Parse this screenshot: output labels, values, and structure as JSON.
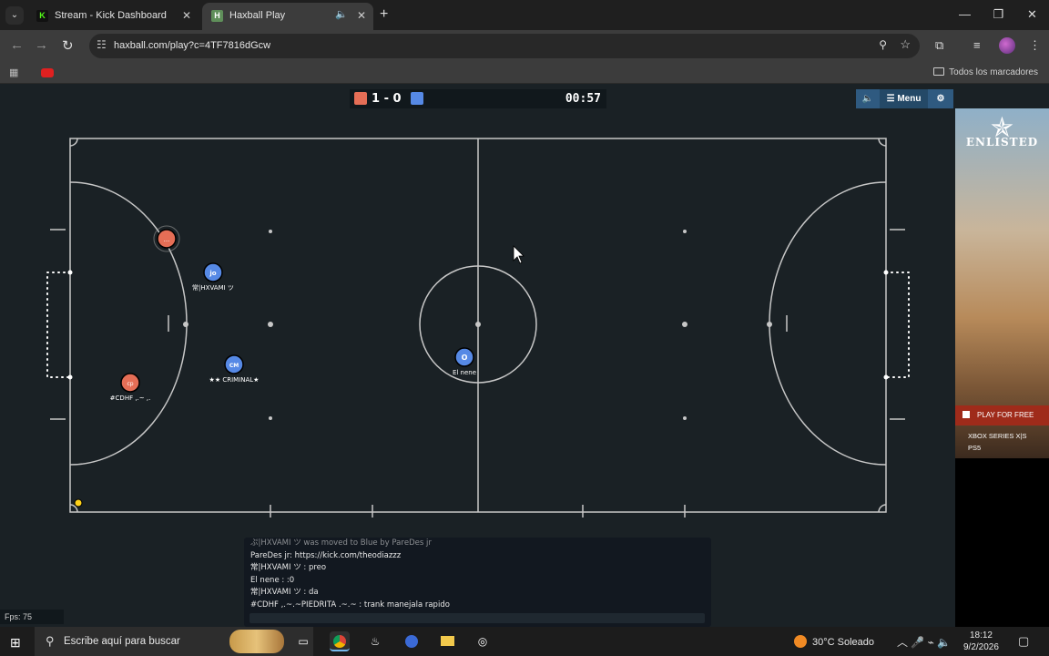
{
  "browser": {
    "tabs": [
      {
        "title": "Stream - Kick Dashboard",
        "favicon": "kick-icon",
        "color": "#53fc18"
      },
      {
        "title": "Haxball Play",
        "favicon": "haxball-icon",
        "color": "#5f8f5a"
      }
    ],
    "url": "haxball.com/play?c=4TF7816dGcw",
    "bookmarks_all": "Todos los marcadores"
  },
  "game": {
    "score": "1 - 0",
    "timer": "00:57",
    "menu_label": "Menu",
    "team_colors": {
      "red": "#e56e56",
      "blue": "#5689e5"
    },
    "players": [
      {
        "team": "red",
        "avatar": "...",
        "name": ""
      },
      {
        "team": "blue",
        "avatar": "jo",
        "name": "常|HXVAMI ツ"
      },
      {
        "team": "blue",
        "avatar": "CM",
        "name": "★★ CRIMINAL★"
      },
      {
        "team": "red",
        "avatar": "cp",
        "name": "#CDHF ,.~ ,."
      },
      {
        "team": "blue",
        "avatar": "O",
        "name": "El nene"
      }
    ],
    "fps": "Fps: 75"
  },
  "chat": {
    "lines": [
      "ぷ|HXVAMI ツ was moved to Blue by ParеDes jr",
      "PareDes jr: https://kick.com/theodiazzz",
      "常|HXVAMI ツ : preo",
      "El nene : :0",
      "常|HXVAMI ツ : da",
      "#CDHF ,.~.~PIEDRITA .~.~ : trank manejala rapido"
    ]
  },
  "ad": {
    "brand": "ENLISTED",
    "cta": "PLAY FOR FREE",
    "platforms": [
      "XBOX SERIES X|S",
      "PS5"
    ]
  },
  "taskbar": {
    "search_placeholder": "Escribe aquí para buscar",
    "weather": "30°C Soleado",
    "time": "18:12",
    "date": "9/2/2026"
  }
}
